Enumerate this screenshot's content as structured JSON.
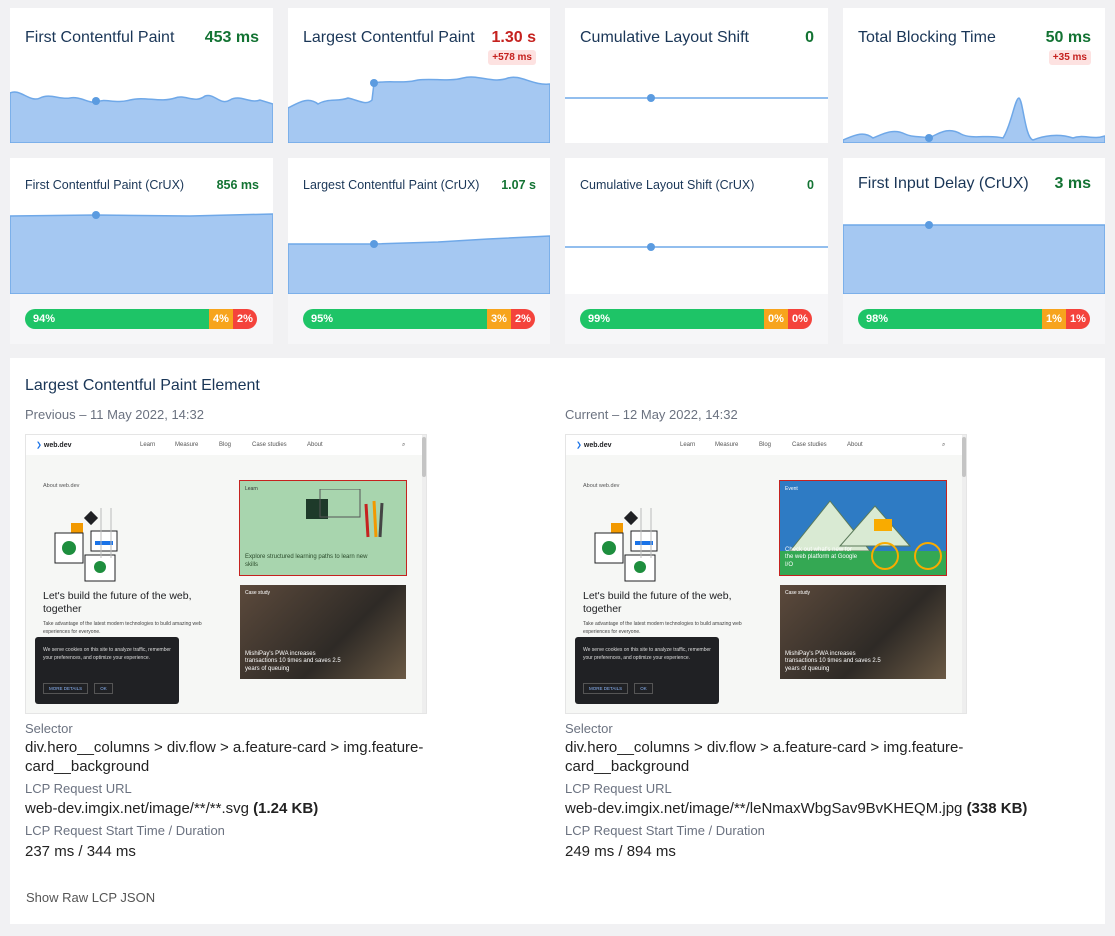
{
  "metrics_top": [
    {
      "title": "First Contentful Paint",
      "value": "453 ms",
      "status": "good",
      "delta": ""
    },
    {
      "title": "Largest Contentful Paint",
      "value": "1.30 s",
      "status": "warn",
      "delta": "+578 ms"
    },
    {
      "title": "Cumulative Layout Shift",
      "value": "0",
      "status": "good",
      "delta": ""
    },
    {
      "title": "Total Blocking Time",
      "value": "50 ms",
      "status": "good",
      "delta": "+35 ms"
    }
  ],
  "metrics_crux": [
    {
      "title": "First Contentful Paint (CrUX)",
      "value": "856 ms",
      "bar": {
        "good": "94%",
        "ni": "4%",
        "poor": "2%"
      }
    },
    {
      "title": "Largest Contentful Paint (CrUX)",
      "value": "1.07 s",
      "bar": {
        "good": "95%",
        "ni": "3%",
        "poor": "2%"
      }
    },
    {
      "title": "Cumulative Layout Shift (CrUX)",
      "value": "0",
      "bar": {
        "good": "99%",
        "ni": "0%",
        "poor": "0%"
      }
    },
    {
      "title": "First Input Delay (CrUX)",
      "value": "3 ms",
      "bar": {
        "good": "98%",
        "ni": "1%",
        "poor": "1%"
      }
    }
  ],
  "colors": {
    "good": "#1ec467",
    "ni": "#f7a41d",
    "poor": "#f4433c",
    "chart_fill": "#a5c8f2",
    "chart_line": "#6fa8e8"
  },
  "lcp": {
    "title": "Largest Contentful Paint Element",
    "previous": {
      "heading": "Previous – 11 May 2022, 14:32",
      "selector_label": "Selector",
      "selector": "div.hero__columns > div.flow > a.feature-card > img.feature-card__background",
      "url_label": "LCP Request URL",
      "url": "web-dev.imgix.net/image/**/**.svg",
      "size": "(1.24 KB)",
      "timing_label": "LCP Request Start Time / Duration",
      "timing": "237 ms / 344 ms",
      "feature_label": "Learn",
      "feature_text": "Explore structured learning paths to learn new skills"
    },
    "current": {
      "heading": "Current – 12 May 2022, 14:32",
      "selector_label": "Selector",
      "selector": "div.hero__columns > div.flow > a.feature-card > img.feature-card__background",
      "url_label": "LCP Request URL",
      "url": "web-dev.imgix.net/image/**/leNmaxWbgSav9BvKHEQM.jpg",
      "size": "(338 KB)",
      "timing_label": "LCP Request Start Time / Duration",
      "timing": "249 ms / 894 ms",
      "feature_label": "Event",
      "feature_text": "Check out what's new for the web platform at Google I/O"
    },
    "show_raw": "Show Raw LCP JSON"
  },
  "webdev_page": {
    "logo": "web.dev",
    "nav": [
      "Learn",
      "Measure",
      "Blog",
      "Case studies",
      "About"
    ],
    "about": "About web.dev",
    "hero": "Let's build the future of the web, together",
    "sub": "Take advantage of the latest modern technologies to build amazing web experiences for everyone.",
    "cookie": "We serve cookies on this site to analyze traffic, remember your preferences, and optimize your experience.",
    "more_details": "MORE DETAILS",
    "ok": "OK",
    "case_label": "Case study",
    "case_text": "MishiPay's PWA increases transactions 10 times and saves 2.5 years of queuing"
  }
}
